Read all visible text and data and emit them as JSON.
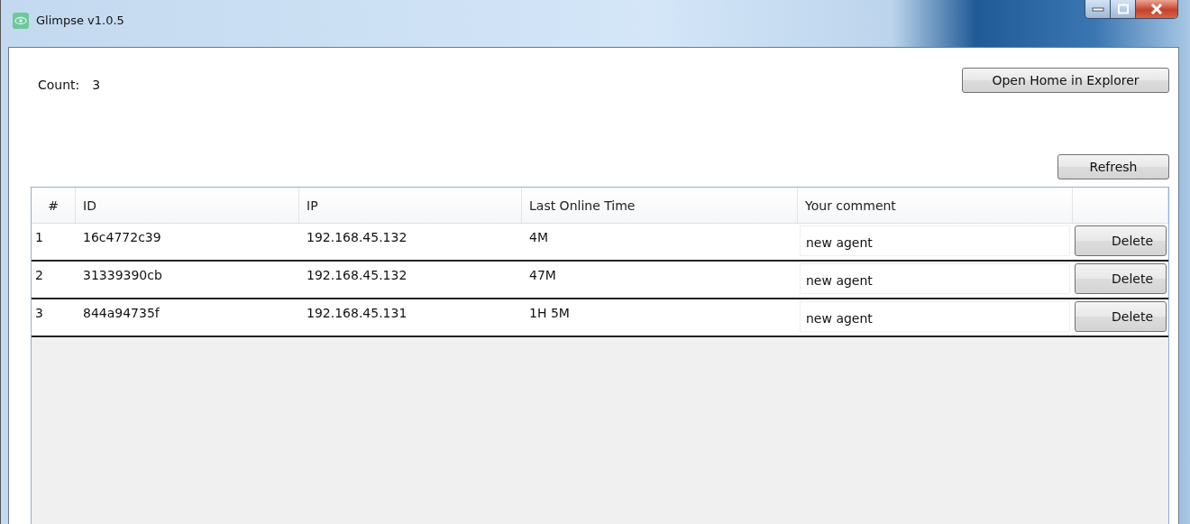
{
  "window": {
    "title": "Glimpse v1.0.5"
  },
  "count": {
    "label": "Count:",
    "value": "3"
  },
  "buttons": {
    "open_home": "Open Home in Explorer",
    "refresh": "Refresh"
  },
  "table": {
    "columns": [
      "#",
      "ID",
      "IP",
      "Last Online Time",
      "Your comment"
    ],
    "rows": [
      {
        "index": "1",
        "id": "16c4772c39",
        "ip": "192.168.45.132",
        "last_online": "4M",
        "comment": "new agent",
        "action": "Delete"
      },
      {
        "index": "2",
        "id": "31339390cb",
        "ip": "192.168.45.132",
        "last_online": "47M",
        "comment": "new agent",
        "action": "Delete"
      },
      {
        "index": "3",
        "id": "844a94735f",
        "ip": "192.168.45.131",
        "last_online": "1H 5M",
        "comment": "new agent",
        "action": "Delete"
      }
    ]
  }
}
